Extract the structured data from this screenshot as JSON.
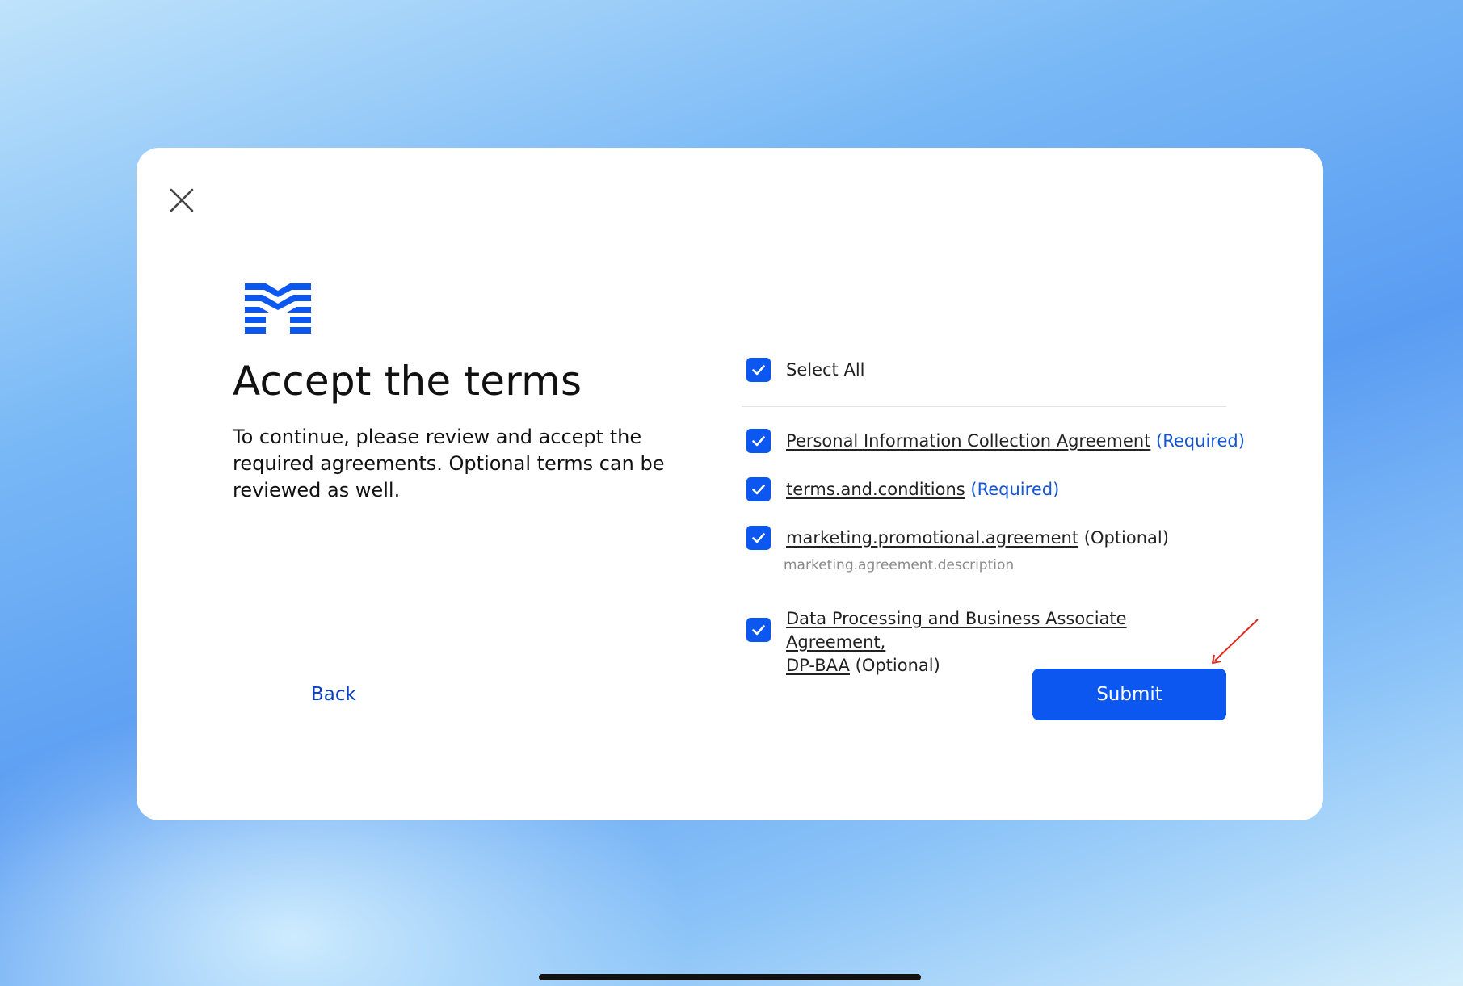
{
  "modal": {
    "title": "Accept the terms",
    "description": "To continue, please review and accept the required agreements. Optional terms can be reviewed as well.",
    "back_label": "Back",
    "submit_label": "Submit"
  },
  "agreements": {
    "select_all": {
      "label": "Select All",
      "checked": true
    },
    "items": [
      {
        "label": "Personal Information Collection Agreement",
        "tag": "(Required)",
        "checked": true
      },
      {
        "label": "terms.and.conditions",
        "tag": "(Required)",
        "checked": true
      },
      {
        "label": "marketing.promotional.agreement",
        "tag": "(Optional)",
        "description": "marketing.agreement.description",
        "checked": true
      },
      {
        "label_line1": "Data Processing and Business Associate Agreement,",
        "label_line2": "DP-BAA",
        "tag": "(Optional)",
        "checked": true
      }
    ]
  },
  "icons": {
    "close": "close-icon",
    "logo": "brand-logo-icon",
    "check": "checkmark-icon",
    "arrow": "annotation-arrow-icon"
  },
  "colors": {
    "accent": "#0b57f0",
    "required_tag": "#1456d4",
    "back_link": "#0a3fbf",
    "annotation": "#e0281f"
  }
}
